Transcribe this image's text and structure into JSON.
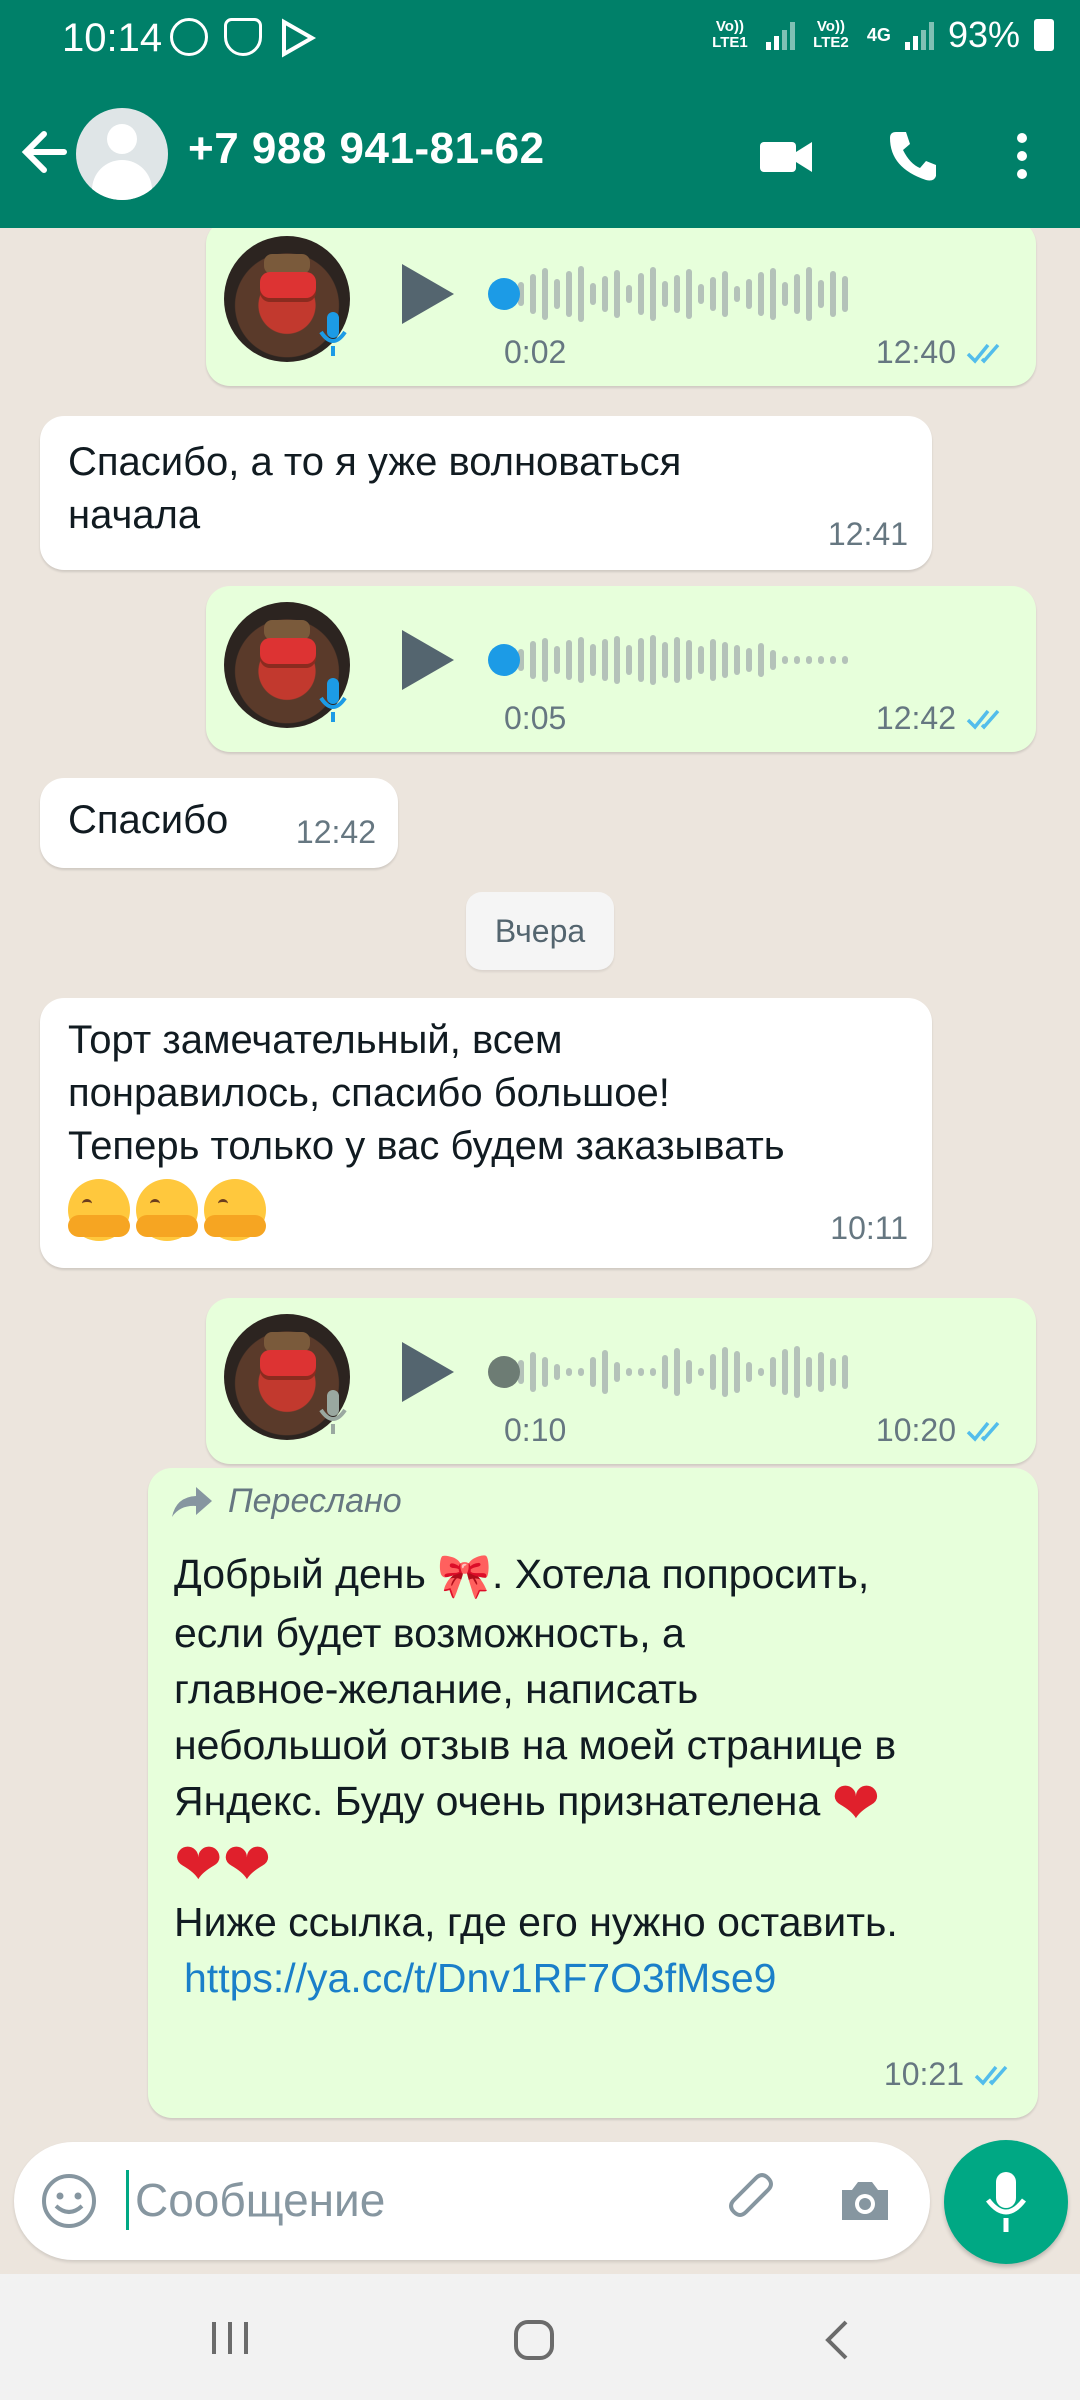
{
  "status_bar": {
    "time": "10:14",
    "net1": "Vo)) LTE1",
    "net2": "Vo)) LTE2",
    "net_type": "4G",
    "battery": "93%"
  },
  "header": {
    "contact": "+7 988 941-81-62",
    "icons": [
      "back-arrow-icon",
      "avatar",
      "video-call-icon",
      "phone-call-icon",
      "more-vert-icon"
    ]
  },
  "messages": [
    {
      "type": "voice",
      "dir": "out",
      "duration": "0:02",
      "time": "12:40",
      "status": "read"
    },
    {
      "type": "text",
      "dir": "in",
      "text_line1": "Спасибо, а то я уже волноваться",
      "text_line2": "начала",
      "time": "12:41"
    },
    {
      "type": "voice",
      "dir": "out",
      "duration": "0:05",
      "time": "12:42",
      "status": "read"
    },
    {
      "type": "text",
      "dir": "in",
      "text": "Спасибо",
      "time": "12:42"
    },
    {
      "type": "date",
      "text": "Вчера"
    },
    {
      "type": "text",
      "dir": "in",
      "line1": "Торт замечательный, всем",
      "line2": "понравилось, спасибо большое!",
      "line3": "Теперь только у вас будем заказывать",
      "emoji": "hugging-face x3",
      "time": "10:11"
    },
    {
      "type": "voice",
      "dir": "out",
      "duration": "0:10",
      "time": "10:20",
      "status": "read"
    },
    {
      "type": "forwarded",
      "dir": "out",
      "label": "Переслано",
      "line1": "Добрый день",
      "line1b": ".  Хотела попросить,",
      "line2": "если будет возможность,  а",
      "line3": "главное-желание,  написать",
      "line4": "небольшой отзыв на моей странице в",
      "line5": "Яндекс.  Буду очень признателена",
      "line7": "Ниже ссылка, где его нужно оставить.",
      "link": "https://ya.cc/t/Dnv1RF7O3fMse9",
      "time": "10:21",
      "status": "read"
    }
  ],
  "composer": {
    "placeholder": "Сообщение"
  }
}
